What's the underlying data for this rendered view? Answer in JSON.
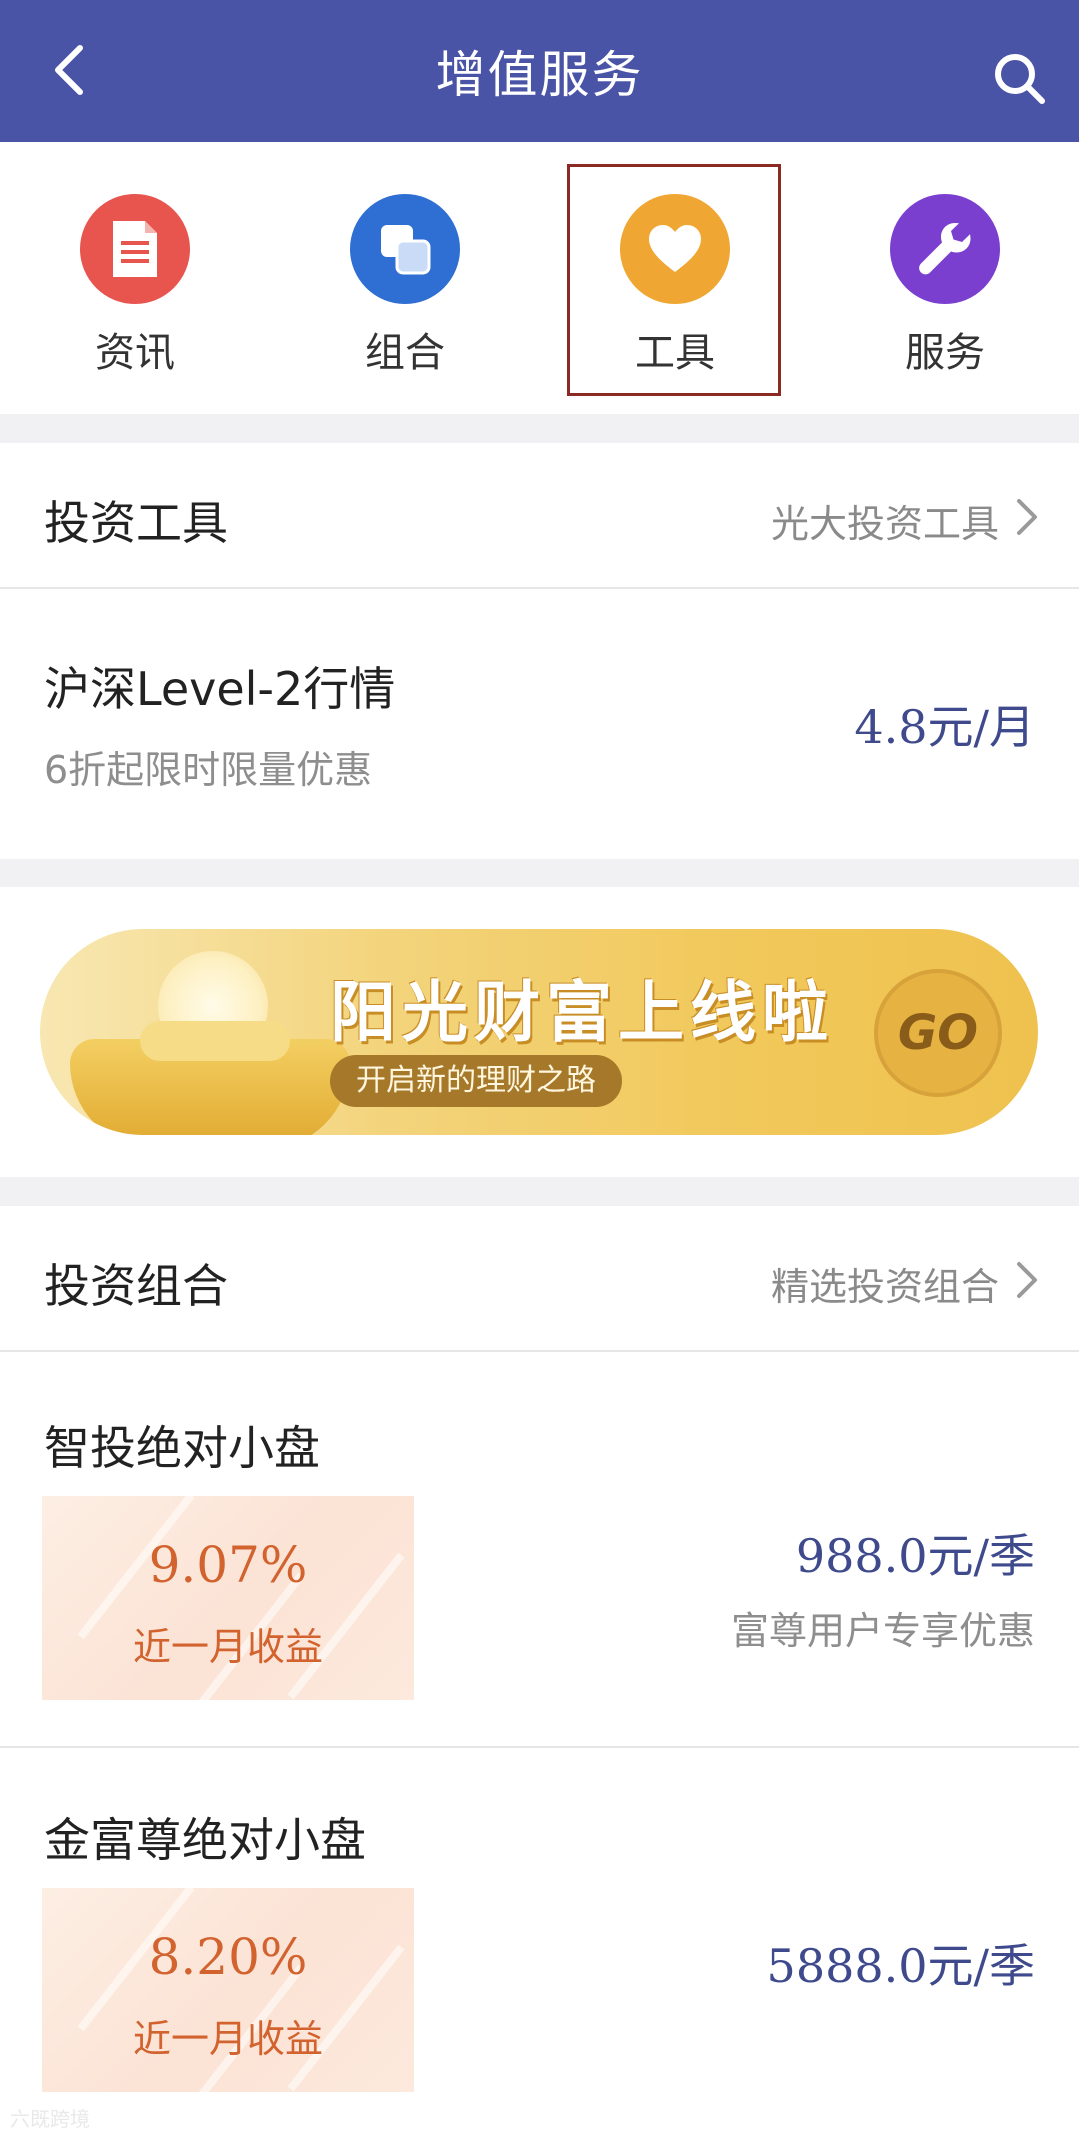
{
  "header": {
    "title": "增值服务",
    "bg_color": "#4a54a6",
    "back_icon": "chevron-left-icon",
    "search_icon": "search-icon"
  },
  "nav": {
    "items": [
      {
        "label": "资讯",
        "icon": "document-icon",
        "color": "#e8554f"
      },
      {
        "label": "组合",
        "icon": "layers-icon",
        "color": "#2f6fd3"
      },
      {
        "label": "工具",
        "icon": "heart-icon",
        "color": "#f0a632",
        "selected": true
      },
      {
        "label": "服务",
        "icon": "wrench-icon",
        "color": "#7b3fd0"
      }
    ]
  },
  "tools_section": {
    "title": "投资工具",
    "link": "光大投资工具",
    "item": {
      "title": "沪深Level-2行情",
      "subtitle": "6折起限时限量优惠",
      "price": "4.8元/月"
    }
  },
  "banner": {
    "headline": "阳光财富上线啦",
    "subline": "开启新的理财之路",
    "go_label": "GO"
  },
  "portfolio_section": {
    "title": "投资组合",
    "link": "精选投资组合",
    "items": [
      {
        "title": "智投绝对小盘",
        "return_value": "9.07%",
        "return_label": "近一月收益",
        "price": "988.0元/季",
        "note": "富尊用户专享优惠"
      },
      {
        "title": "金富尊绝对小盘",
        "return_value": "8.20%",
        "return_label": "近一月收益",
        "price": "5888.0元/季"
      }
    ]
  },
  "watermark": "六既跨境"
}
